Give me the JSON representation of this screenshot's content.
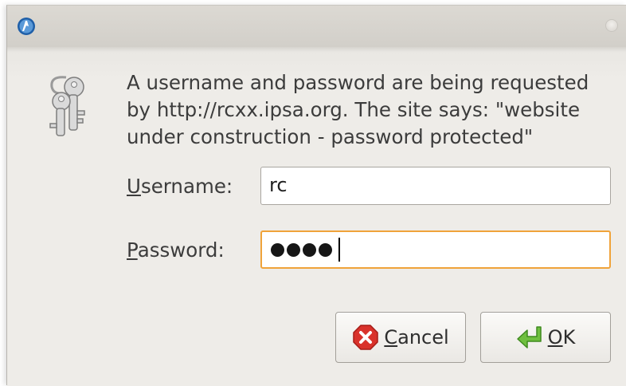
{
  "dialog": {
    "message": "A username and password are being requested\nby http://rcxx.ipsa.org. The site says: \"website\nunder construction - password protected\""
  },
  "username": {
    "label_mnemonic": "U",
    "label_rest": "sername:",
    "value": "rc"
  },
  "password": {
    "label_mnemonic": "P",
    "label_rest": "assword:",
    "masked_length": 4
  },
  "buttons": {
    "cancel_mnemonic": "C",
    "cancel_rest": "ancel",
    "ok_mnemonic": "O",
    "ok_rest": "K"
  },
  "icons": {
    "app": "firefox-icon",
    "dialog": "keys-icon",
    "cancel": "cancel-icon",
    "ok": "ok-arrow-icon"
  },
  "colors": {
    "focus_border": "#f0a33a",
    "cancel_red": "#d9322b",
    "ok_green": "#6fbf3f"
  }
}
